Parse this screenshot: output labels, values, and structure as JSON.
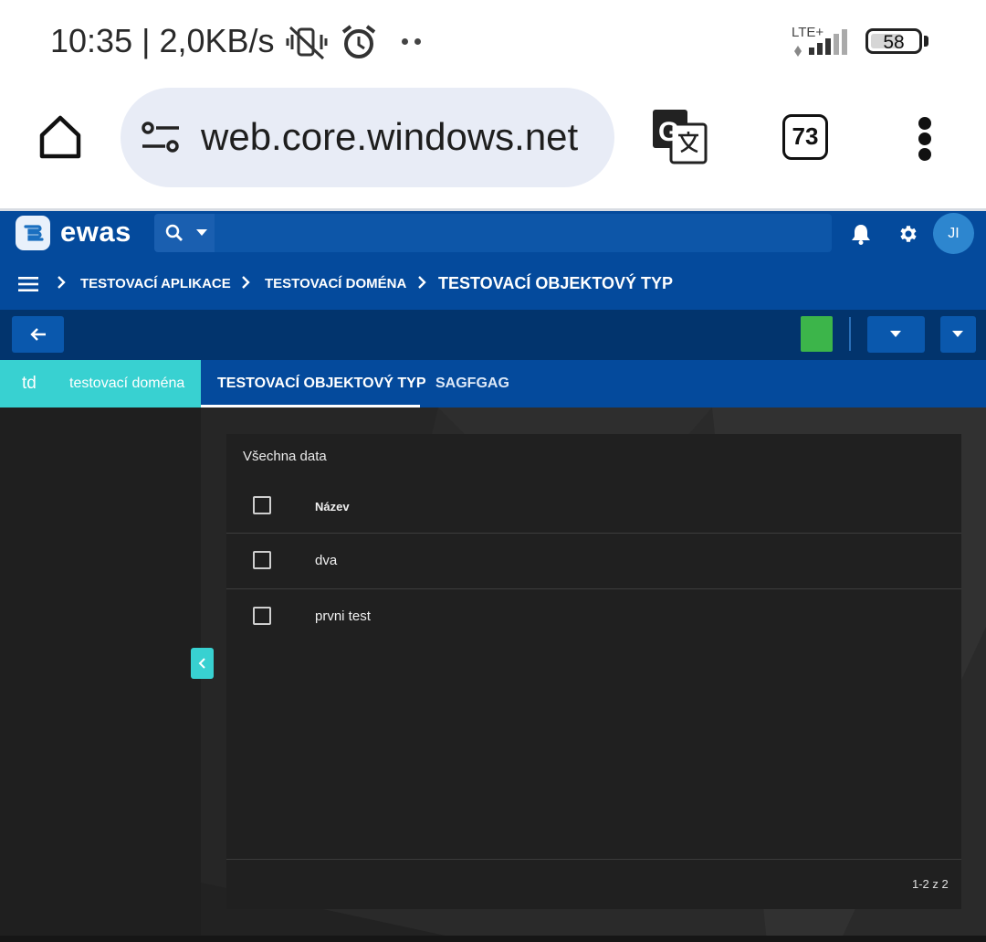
{
  "status_bar": {
    "time": "10:35 | 2,0KB/s",
    "network": "LTE+",
    "battery": "58"
  },
  "browser": {
    "url": "web.core.windows.net",
    "tab_count": "73"
  },
  "app": {
    "logo": "ewas",
    "search": {
      "placeholder": ""
    },
    "user_initials": "JI"
  },
  "breadcrumb": [
    "TESTOVACÍ APLIKACE",
    "TESTOVACÍ DOMÉNA",
    "TESTOVACÍ OBJEKTOVÝ TYP"
  ],
  "domain_tab": {
    "abbr": "td",
    "name": "testovací doména"
  },
  "tabs": [
    "TESTOVACÍ OBJEKTOVÝ TYP",
    "SAGFGAG"
  ],
  "table": {
    "title": "Všechna data",
    "column": "Název",
    "rows": [
      "dva",
      "prvni test"
    ],
    "pagination": "1-2 z 2"
  },
  "colors": {
    "header": "#044a9c",
    "toolbar": "#02346d",
    "accent": "#38d1d1",
    "green": "#3cb54a"
  }
}
